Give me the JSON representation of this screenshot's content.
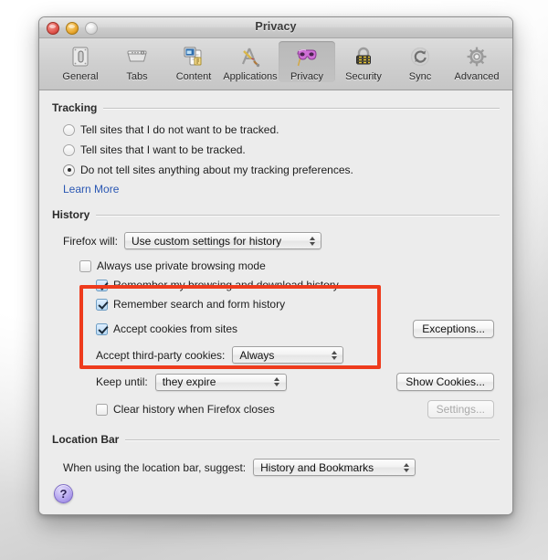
{
  "window": {
    "title": "Privacy",
    "traffic_lights": [
      "close",
      "minimize",
      "zoom"
    ]
  },
  "toolbar": {
    "items": [
      {
        "label": "General",
        "icon": "general-icon",
        "selected": false
      },
      {
        "label": "Tabs",
        "icon": "tabs-icon",
        "selected": false
      },
      {
        "label": "Content",
        "icon": "content-icon",
        "selected": false
      },
      {
        "label": "Applications",
        "icon": "applications-icon",
        "selected": false
      },
      {
        "label": "Privacy",
        "icon": "privacy-mask-icon",
        "selected": true
      },
      {
        "label": "Security",
        "icon": "security-lock-icon",
        "selected": false
      },
      {
        "label": "Sync",
        "icon": "sync-icon",
        "selected": false
      },
      {
        "label": "Advanced",
        "icon": "advanced-gear-icon",
        "selected": false
      }
    ]
  },
  "tracking": {
    "heading": "Tracking",
    "options": [
      {
        "label": "Tell sites that I do not want to be tracked.",
        "selected": false
      },
      {
        "label": "Tell sites that I want to be tracked.",
        "selected": false
      },
      {
        "label": "Do not tell sites anything about my tracking preferences.",
        "selected": true
      }
    ],
    "learn_more": "Learn More"
  },
  "history": {
    "heading": "History",
    "firefox_will_label": "Firefox will:",
    "firefox_will_value": "Use custom settings for history",
    "private_browsing": {
      "label": "Always use private browsing mode",
      "checked": false
    },
    "remember_browsing": {
      "label": "Remember my browsing and download history",
      "checked": true
    },
    "remember_search": {
      "label": "Remember search and form history",
      "checked": true
    },
    "accept_cookies": {
      "label": "Accept cookies from sites",
      "checked": true
    },
    "third_party_label": "Accept third-party cookies:",
    "third_party_value": "Always",
    "keep_until_label": "Keep until:",
    "keep_until_value": "they expire",
    "clear_history": {
      "label": "Clear history when Firefox closes",
      "checked": false
    },
    "exceptions_button": "Exceptions...",
    "show_cookies_button": "Show Cookies...",
    "settings_button": "Settings...",
    "settings_disabled": true
  },
  "location_bar": {
    "heading": "Location Bar",
    "suggest_label": "When using the location bar, suggest:",
    "suggest_value": "History and Bookmarks"
  },
  "help": {
    "label": "?"
  },
  "colors": {
    "highlight_box": "#ee3b1d",
    "link": "#2a57b3",
    "checkbox_on": "#b9d9f4"
  }
}
